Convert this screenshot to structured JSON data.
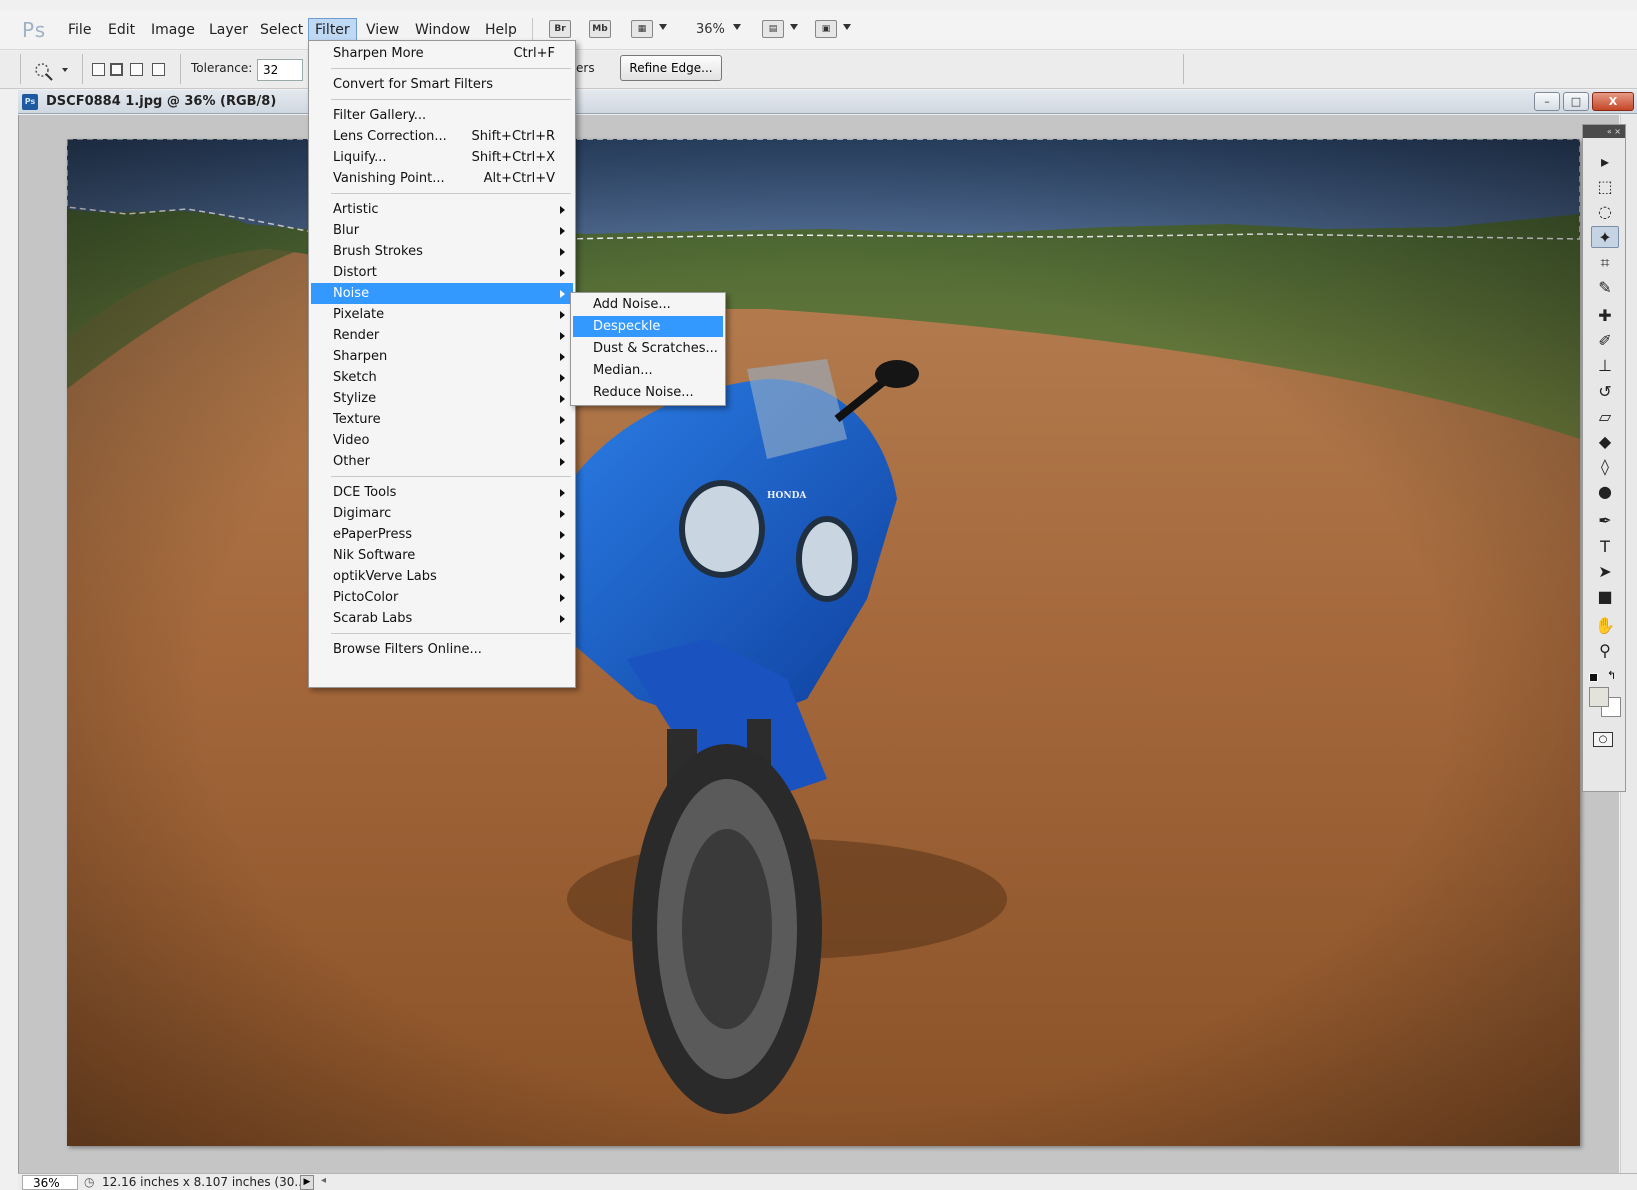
{
  "app": {
    "logo": "Ps"
  },
  "menubar": {
    "items": [
      "File",
      "Edit",
      "Image",
      "Layer",
      "Select",
      "Filter",
      "View",
      "Window",
      "Help"
    ],
    "active": "Filter",
    "br_label": "Br",
    "mb_label": "Mb",
    "zoom": "36%"
  },
  "options_bar": {
    "tolerance_label": "Tolerance:",
    "tolerance_value": "32",
    "partial_label": "ers",
    "refine_edge_label": "Refine Edge..."
  },
  "document": {
    "title": "DSCF0884 1.jpg @ 36% (RGB/8)",
    "icon_label": "Ps",
    "window_buttons": {
      "minimize": "–",
      "restore": "□",
      "close": "X"
    }
  },
  "filter_menu": {
    "items": [
      {
        "label": "Sharpen More",
        "shortcut": "Ctrl+F"
      },
      {
        "label": "Convert for Smart Filters",
        "shortcut": ""
      },
      {
        "label": "Filter Gallery...",
        "shortcut": ""
      },
      {
        "label": "Lens Correction...",
        "shortcut": "Shift+Ctrl+R"
      },
      {
        "label": "Liquify...",
        "shortcut": "Shift+Ctrl+X"
      },
      {
        "label": "Vanishing Point...",
        "shortcut": "Alt+Ctrl+V"
      },
      {
        "label": "Artistic"
      },
      {
        "label": "Blur"
      },
      {
        "label": "Brush Strokes"
      },
      {
        "label": "Distort"
      },
      {
        "label": "Noise"
      },
      {
        "label": "Pixelate"
      },
      {
        "label": "Render"
      },
      {
        "label": "Sharpen"
      },
      {
        "label": "Sketch"
      },
      {
        "label": "Stylize"
      },
      {
        "label": "Texture"
      },
      {
        "label": "Video"
      },
      {
        "label": "Other"
      },
      {
        "label": "DCE Tools"
      },
      {
        "label": "Digimarc"
      },
      {
        "label": "ePaperPress"
      },
      {
        "label": "Nik Software"
      },
      {
        "label": "optikVerve Labs"
      },
      {
        "label": "PictoColor"
      },
      {
        "label": "Scarab Labs"
      },
      {
        "label": "Browse Filters Online..."
      }
    ],
    "highlighted": "Noise"
  },
  "noise_submenu": {
    "items": [
      "Add Noise...",
      "Despeckle",
      "Dust & Scratches...",
      "Median...",
      "Reduce Noise..."
    ],
    "highlighted": "Despeckle"
  },
  "canvas": {
    "honda_badge": "HONDA"
  },
  "tools_panel": {
    "header": "« ×",
    "tools": [
      "move-tool",
      "marquee-tool",
      "lasso-tool",
      "quick-selection-tool",
      "crop-tool",
      "eyedropper-tool",
      "spot-healing-tool",
      "brush-tool",
      "clone-stamp-tool",
      "history-brush-tool",
      "eraser-tool",
      "paint-bucket-tool",
      "blur-tool",
      "dodge-tool",
      "pen-tool",
      "type-tool",
      "path-selection-tool",
      "rectangle-tool",
      "hand-tool",
      "zoom-tool"
    ],
    "active_tool": "quick-selection-tool",
    "colors": {
      "foreground": "#e3e3dc",
      "background": "#ffffff"
    }
  },
  "status_bar": {
    "zoom": "36%",
    "doc_info": "12.16 inches x 8.107 inches (30..."
  }
}
